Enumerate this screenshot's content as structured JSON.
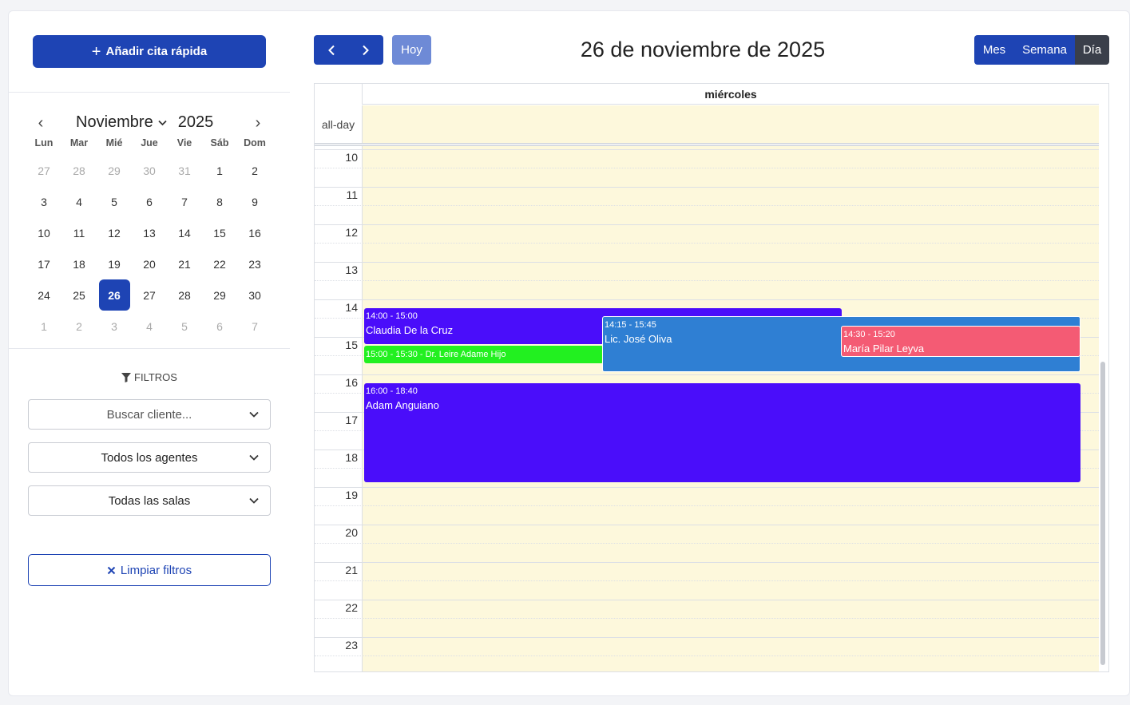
{
  "sidebar": {
    "quick_add_label": "Añadir cita rápida",
    "mini_calendar": {
      "month": "Noviembre",
      "year": "2025",
      "weekdays": [
        "Lun",
        "Mar",
        "Mié",
        "Jue",
        "Vie",
        "Sáb",
        "Dom"
      ],
      "weeks": [
        [
          "27",
          "28",
          "29",
          "30",
          "31",
          "1",
          "2"
        ],
        [
          "3",
          "4",
          "5",
          "6",
          "7",
          "8",
          "9"
        ],
        [
          "10",
          "11",
          "12",
          "13",
          "14",
          "15",
          "16"
        ],
        [
          "17",
          "18",
          "19",
          "20",
          "21",
          "22",
          "23"
        ],
        [
          "24",
          "25",
          "26",
          "27",
          "28",
          "29",
          "30"
        ],
        [
          "1",
          "2",
          "3",
          "4",
          "5",
          "6",
          "7"
        ]
      ],
      "selected": "26"
    },
    "filters_title": "FILTROS",
    "client_search_placeholder": "Buscar cliente...",
    "agents_select": "Todos los agentes",
    "rooms_select": "Todas las salas",
    "clear_filters_label": "Limpiar filtros"
  },
  "toolbar": {
    "today_label": "Hoy",
    "title": "26 de noviembre de 2025",
    "views": [
      "Mes",
      "Semana",
      "Día"
    ],
    "active_view": "Día"
  },
  "calendar": {
    "day_header": "miércoles",
    "allday_label": "all-day",
    "hours": [
      "10",
      "11",
      "12",
      "13",
      "14",
      "15",
      "16",
      "17",
      "18",
      "19",
      "20",
      "21",
      "22",
      "23"
    ],
    "events": {
      "claudia": {
        "time": "14:00 - 15:00",
        "title": "Claudia De la Cruz",
        "color": "#4a0dfa"
      },
      "leire": {
        "time": "15:00 - 15:30 - Dr. Leire Adame Hijo",
        "color": "#22f020"
      },
      "jose": {
        "time": "14:15 - 15:45",
        "title": "Lic. José Oliva",
        "color": "#2f7fd3"
      },
      "maria": {
        "time": "14:30 - 15:20",
        "title": "María Pilar Leyva",
        "color": "#f45b74"
      },
      "adam": {
        "time": "16:00 - 18:40",
        "title": "Adam Anguiano",
        "color": "#4a0dfa"
      }
    }
  }
}
